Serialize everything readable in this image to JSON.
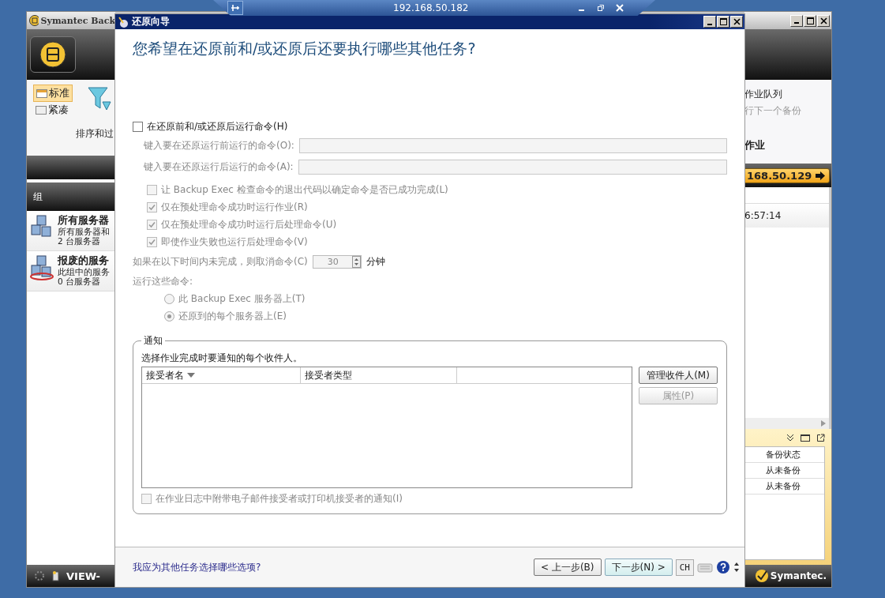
{
  "remote_bar": {
    "address": "192.168.50.182"
  },
  "app_window": {
    "title": "Symantec Back",
    "view_options": [
      {
        "label": "标准",
        "selected": true
      },
      {
        "label": "紧凑",
        "selected": false
      }
    ],
    "sort_filter_label": "排序和过",
    "groups_header": "组",
    "groups": [
      {
        "name": "所有服务器",
        "description": "所有服务器和",
        "count": "2 台服务器"
      },
      {
        "name": "报废的服务",
        "description": "此组中的服务",
        "count": "0 台服务器"
      }
    ],
    "taskbar_label": "VIEW-",
    "right_pane": {
      "queue_title": "作业队列",
      "queue_hint": "行下一个备份",
      "jobs_heading": "作业",
      "server_button": "168.50.129",
      "time": "6:57:14",
      "table": {
        "columns": [
          "备份状态"
        ],
        "rows": [
          [
            "从未备份"
          ],
          [
            "从未备份"
          ]
        ]
      }
    },
    "brand": "Symantec."
  },
  "wizard": {
    "title": "还原向导",
    "heading": "您希望在还原前和/或还原后还要执行哪些其他任务?",
    "run_commands": {
      "label": "在还原前和/或还原后运行命令(H)",
      "checked": false
    },
    "command_fields": [
      {
        "label": "键入要在还原运行前运行的命令(O):",
        "disabled": true
      },
      {
        "label": "键入要在还原运行后运行的命令(A):",
        "disabled": true
      }
    ],
    "options": [
      {
        "label": "让 Backup Exec 检查命令的退出代码以确定命令是否已成功完成(L)",
        "checked": false,
        "disabled": true
      },
      {
        "label": "仅在预处理命令成功时运行作业(R)",
        "checked": true,
        "disabled": true
      },
      {
        "label": "仅在预处理命令成功时运行后处理命令(U)",
        "checked": true,
        "disabled": true
      },
      {
        "label": "即使作业失败也运行后处理命令(V)",
        "checked": true,
        "disabled": true
      }
    ],
    "timeout": {
      "label": "如果在以下时间内未完成，则取消命令(C)",
      "value": "30",
      "unit": "分钟"
    },
    "run_on": {
      "label": "运行这些命令:",
      "choices": [
        {
          "label": "此 Backup Exec 服务器上(T)",
          "selected": false
        },
        {
          "label": "还原到的每个服务器上(E)",
          "selected": true
        }
      ]
    },
    "notification": {
      "title": "通知",
      "description": "选择作业完成时要通知的每个收件人。",
      "columns": [
        "接受者名",
        "接受者类型"
      ],
      "buttons": [
        {
          "label": "管理收件人(M)",
          "disabled": false
        },
        {
          "label": "属性(P)",
          "disabled": true
        }
      ],
      "attach": {
        "label": "在作业日志中附带电子邮件接受者或打印机接受者的通知(I)",
        "checked": false,
        "disabled": true
      }
    },
    "help_link": "我应为其他任务选择哪些选项?",
    "nav_buttons": [
      {
        "label": "< 上一步(B)",
        "focused": false
      },
      {
        "label": "下一步(N) >",
        "focused": true
      }
    ],
    "language": "CH"
  }
}
